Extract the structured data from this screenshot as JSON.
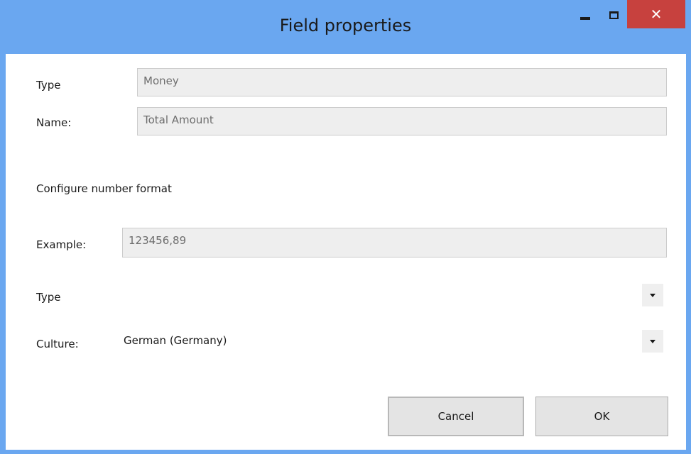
{
  "window": {
    "title": "Field properties",
    "close_glyph": "✕"
  },
  "field": {
    "type_label": "Type",
    "type_value": "Money",
    "name_label": "Name:",
    "name_value": "Total Amount"
  },
  "format": {
    "section_title": "Configure number format",
    "example_label": "Example:",
    "example_value": "123456,89",
    "type_label": "Type",
    "type_value": "",
    "culture_label": "Culture:",
    "culture_value": "German (Germany)"
  },
  "buttons": {
    "cancel": "Cancel",
    "ok": "OK"
  },
  "icons": {
    "minimize": "minimize-icon",
    "maximize": "maximize-icon",
    "close": "close-icon",
    "dropdown": "chevron-down-icon"
  },
  "colors": {
    "titlebar": "#6aa7f0",
    "close": "#c7413e",
    "field_bg": "#eeeeee"
  }
}
